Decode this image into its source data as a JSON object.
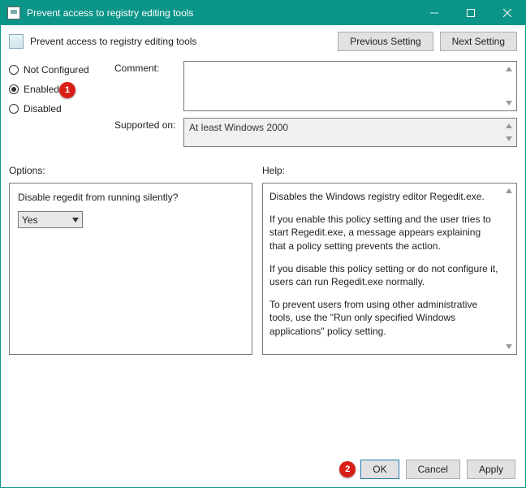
{
  "titlebar": {
    "title": "Prevent access to registry editing tools"
  },
  "header": {
    "title": "Prevent access to registry editing tools",
    "prev_btn": "Previous Setting",
    "next_btn": "Next Setting"
  },
  "radios": {
    "not_configured": "Not Configured",
    "enabled": "Enabled",
    "disabled": "Disabled",
    "selected": "enabled"
  },
  "annotations": {
    "badge1": "1",
    "badge2": "2"
  },
  "comment": {
    "label": "Comment:",
    "value": ""
  },
  "supported": {
    "label": "Supported on:",
    "value": "At least Windows 2000"
  },
  "sections": {
    "options_label": "Options:",
    "help_label": "Help:"
  },
  "options": {
    "question": "Disable regedit from running silently?",
    "dropdown_value": "Yes"
  },
  "help": {
    "p1": "Disables the Windows registry editor Regedit.exe.",
    "p2": "If you enable this policy setting and the user tries to start Regedit.exe, a message appears explaining that a policy setting prevents the action.",
    "p3": "If you disable this policy setting or do not configure it, users can run Regedit.exe normally.",
    "p4": "To prevent users from using other administrative tools, use the \"Run only specified Windows applications\" policy setting."
  },
  "footer": {
    "ok": "OK",
    "cancel": "Cancel",
    "apply": "Apply"
  }
}
